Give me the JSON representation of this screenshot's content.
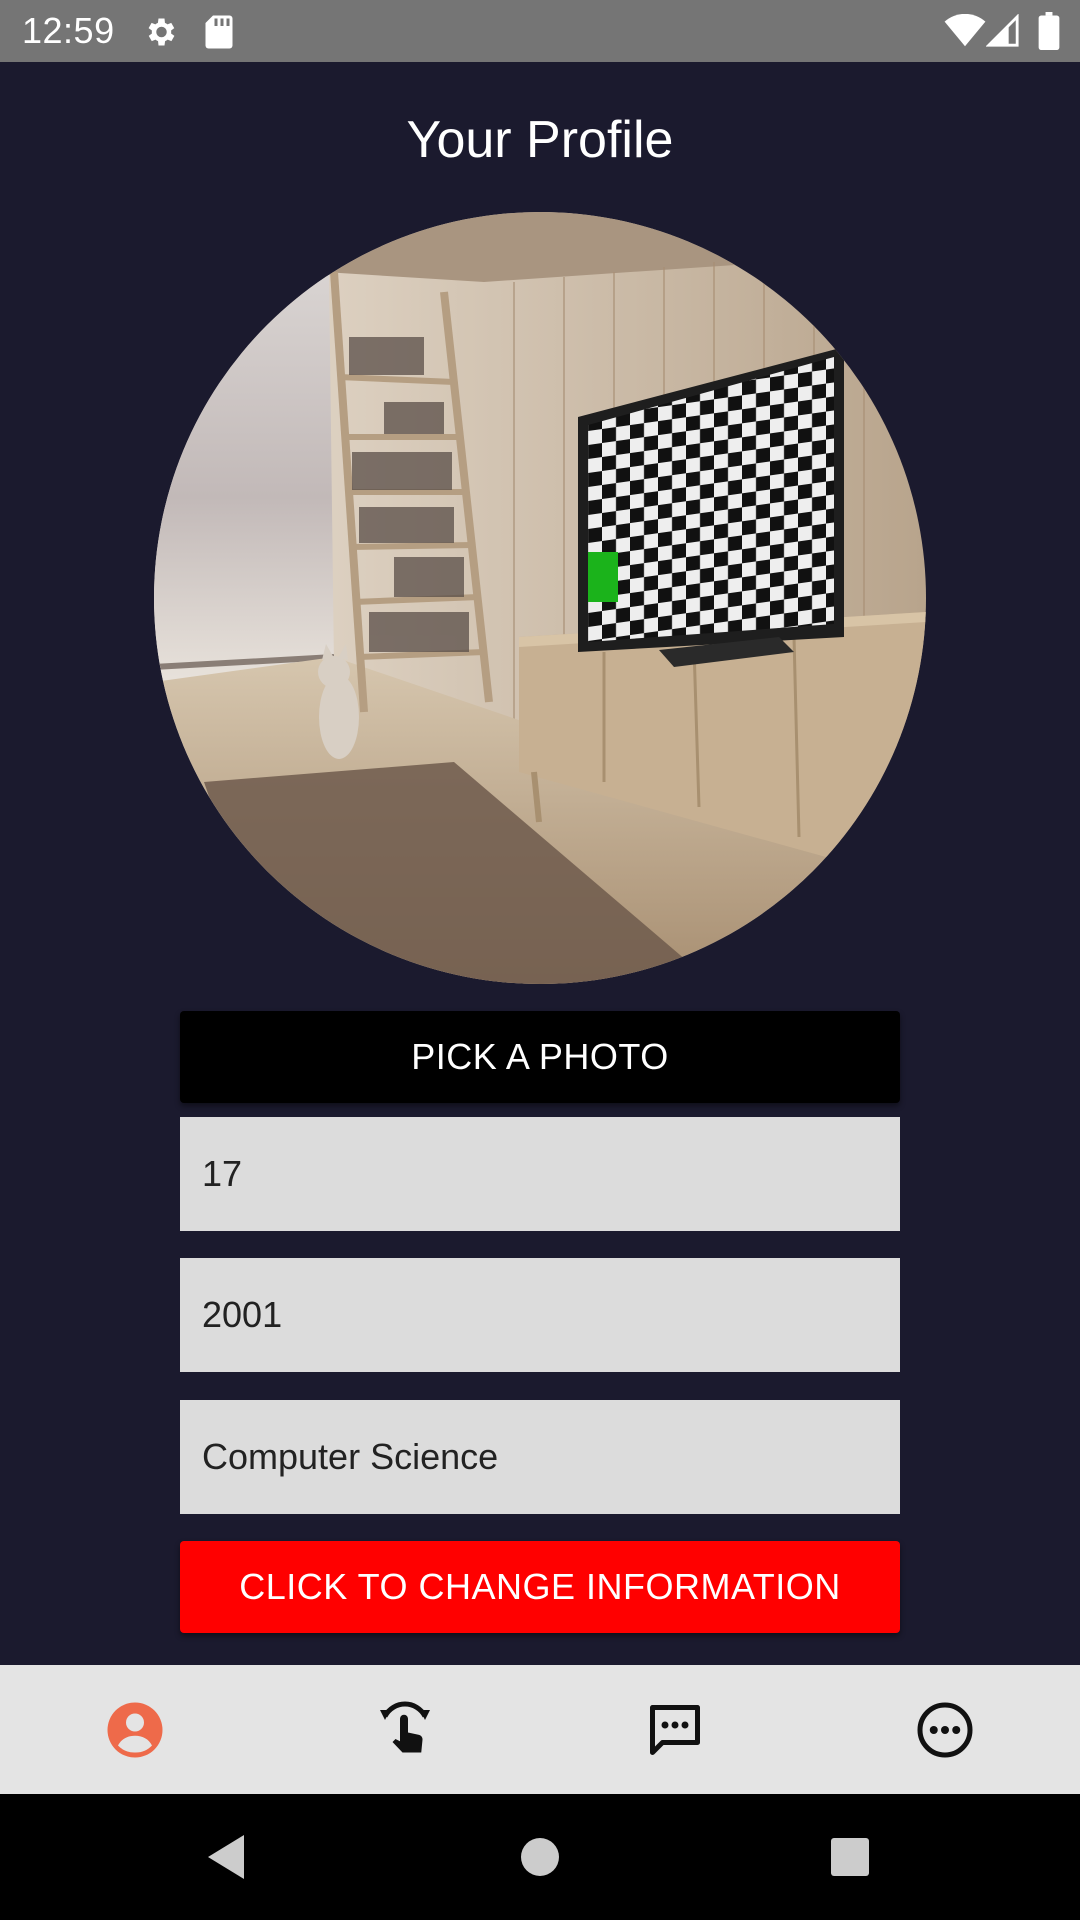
{
  "status_bar": {
    "time": "12:59",
    "icons": [
      "gear-icon",
      "sd-card-icon",
      "wifi-icon",
      "signal-icon",
      "battery-icon"
    ]
  },
  "page": {
    "title": "Your Profile",
    "profile_photo": "room-with-tv-and-cat"
  },
  "actions": {
    "pick_photo_label": "PICK A PHOTO",
    "change_info_label": "CLICK TO CHANGE INFORMATION"
  },
  "fields": {
    "age": "17",
    "year": "2001",
    "major": "Computer Science"
  },
  "tab_bar": {
    "tabs": [
      {
        "icon": "profile-icon",
        "active": true
      },
      {
        "icon": "touch-swipe-icon",
        "active": false
      },
      {
        "icon": "chat-icon",
        "active": false
      },
      {
        "icon": "more-icon",
        "active": false
      }
    ]
  },
  "colors": {
    "background": "#1b1a2e",
    "status_bar": "#757575",
    "pick_button": "#000000",
    "change_button": "#ff0000",
    "field_bg": "#dcdcdc",
    "tab_bar": "#e4e4e4",
    "active_tab": "#ee6a4a"
  }
}
